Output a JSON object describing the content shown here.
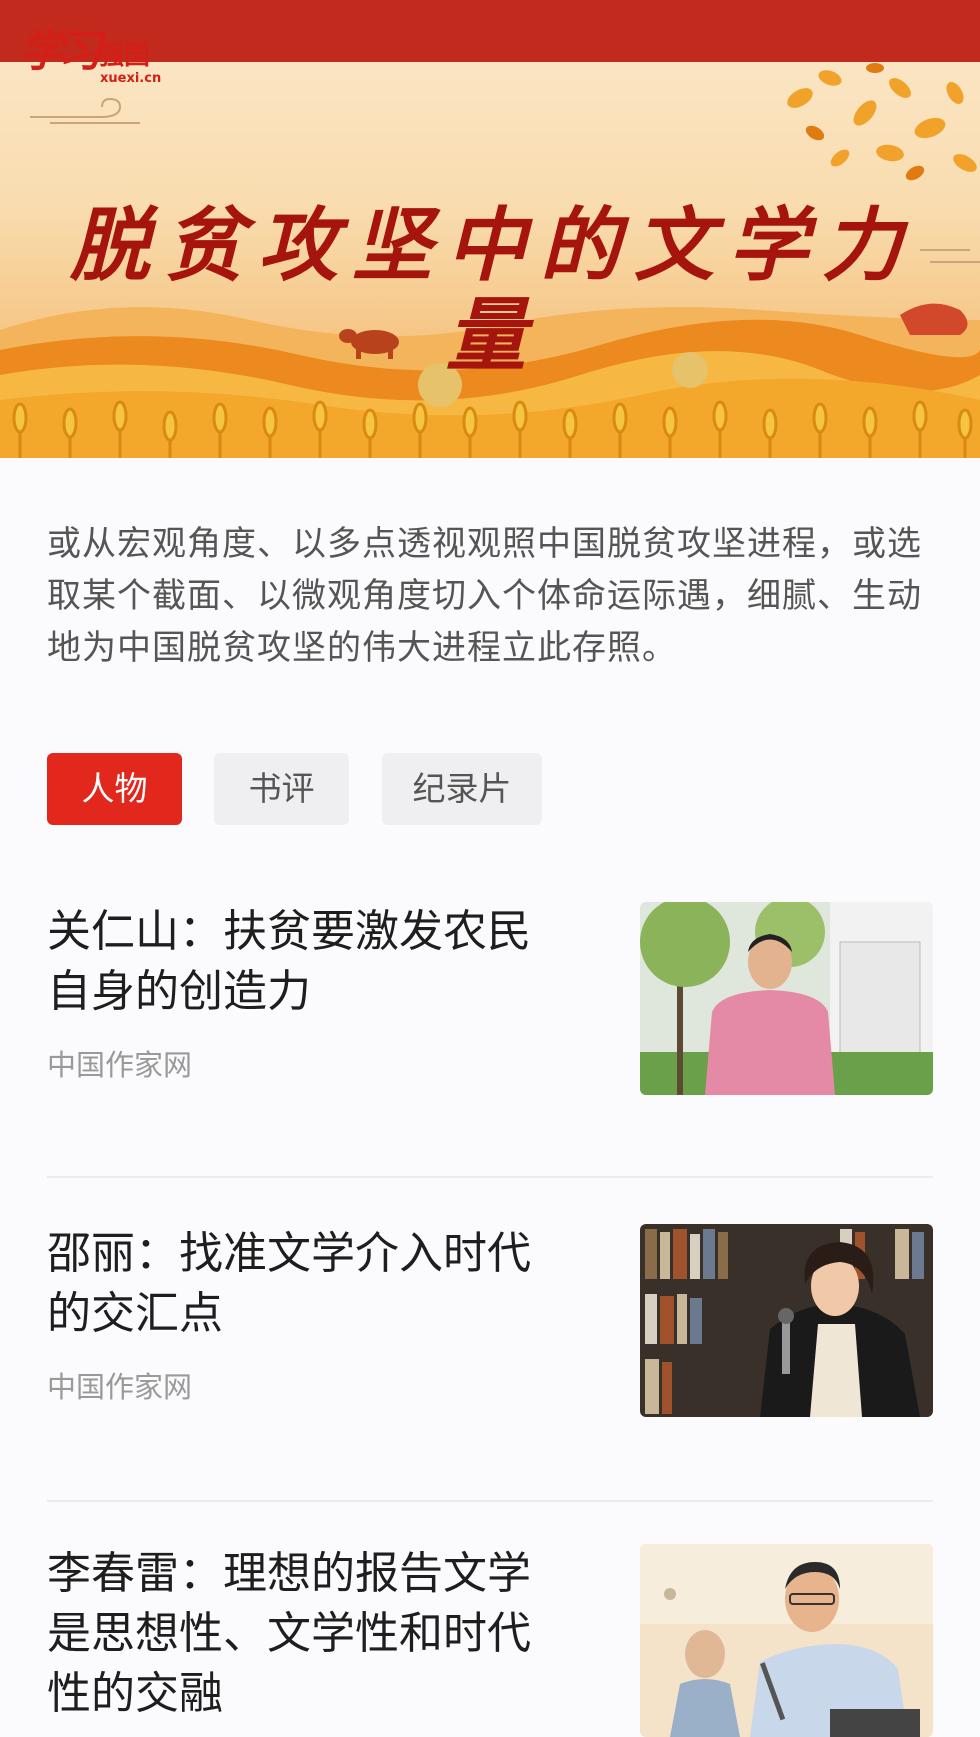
{
  "banner": {
    "logo_mark": "学习",
    "logo_cn": "强国",
    "logo_en": "xuexi.cn",
    "title": "脱贫攻坚中的文学力量"
  },
  "intro": "或从宏观角度、以多点透视观照中国脱贫攻坚进程，或选取某个截面、以微观角度切入个体命运际遇，细腻、生动地为中国脱贫攻坚的伟大进程立此存照。",
  "tabs": [
    {
      "label": "人物",
      "active": true
    },
    {
      "label": "书评",
      "active": false
    },
    {
      "label": "纪录片",
      "active": false
    }
  ],
  "articles": [
    {
      "title": "关仁山：扶贫要激发农民自身的创造力",
      "source": "中国作家网",
      "thumb_icon": "portrait-photo"
    },
    {
      "title": "邵丽：找准文学介入时代的交汇点",
      "source": "中国作家网",
      "thumb_icon": "portrait-photo"
    },
    {
      "title": "李春雷：理想的报告文学是思想性、文学性和时代性的交融",
      "source": "",
      "thumb_icon": "portrait-photo"
    }
  ],
  "colors": {
    "brand_red": "#c32a1e",
    "tab_active": "#e2281c",
    "tab_inactive": "#efeff1",
    "source_gray": "#999999"
  }
}
